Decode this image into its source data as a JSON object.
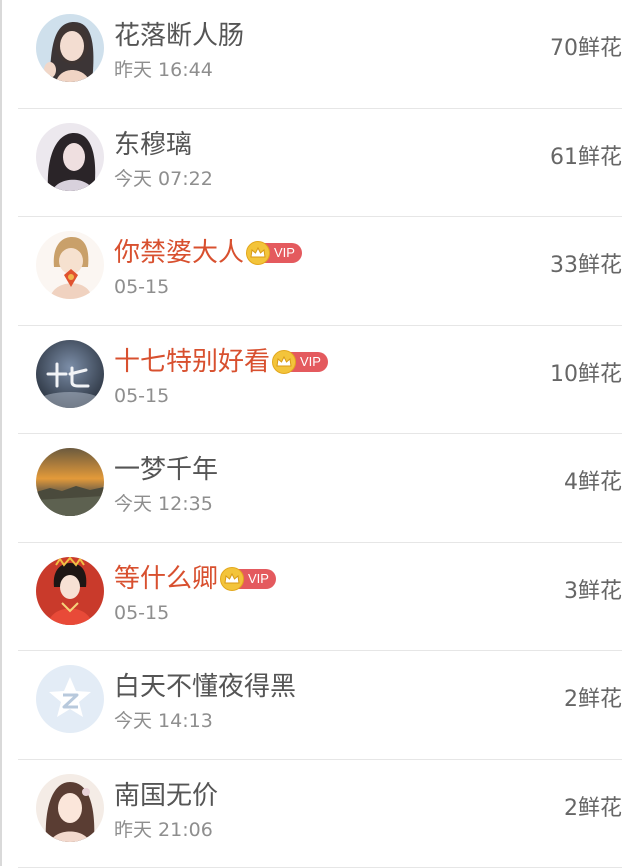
{
  "flower_list": [
    {
      "name": "花落断人肠",
      "time": "昨天 16:44",
      "flowers": "70鲜花",
      "vip": false,
      "avatar": "avatar-girl-long-hair"
    },
    {
      "name": "东穆璃",
      "time": "今天 07:22",
      "flowers": "61鲜花",
      "vip": false,
      "avatar": "avatar-girl-portrait"
    },
    {
      "name": "你禁婆大人",
      "time": "05-15",
      "flowers": "33鲜花",
      "vip": true,
      "vip_label": "VIP",
      "avatar": "avatar-anime-character"
    },
    {
      "name": "十七特别好看",
      "time": "05-15",
      "flowers": "10鲜花",
      "vip": true,
      "vip_label": "VIP",
      "avatar": "avatar-calligraphy-text"
    },
    {
      "name": "一梦千年",
      "time": "今天 12:35",
      "flowers": "4鲜花",
      "vip": false,
      "avatar": "avatar-sunset-landscape"
    },
    {
      "name": "等什么卿",
      "time": "05-15",
      "flowers": "3鲜花",
      "vip": true,
      "vip_label": "VIP",
      "avatar": "avatar-red-costume-girl"
    },
    {
      "name": "白天不懂夜得黑",
      "time": "今天 14:13",
      "flowers": "2鲜花",
      "vip": false,
      "avatar": "avatar-default-placeholder"
    },
    {
      "name": "南国无价",
      "time": "昨天 21:06",
      "flowers": "2鲜花",
      "vip": false,
      "avatar": "avatar-anime-girl"
    }
  ],
  "colors": {
    "vip_name": "#d8502f",
    "normal_name": "#555555",
    "vip_tag": "#e45a5e",
    "crown": "#f3c43b"
  }
}
